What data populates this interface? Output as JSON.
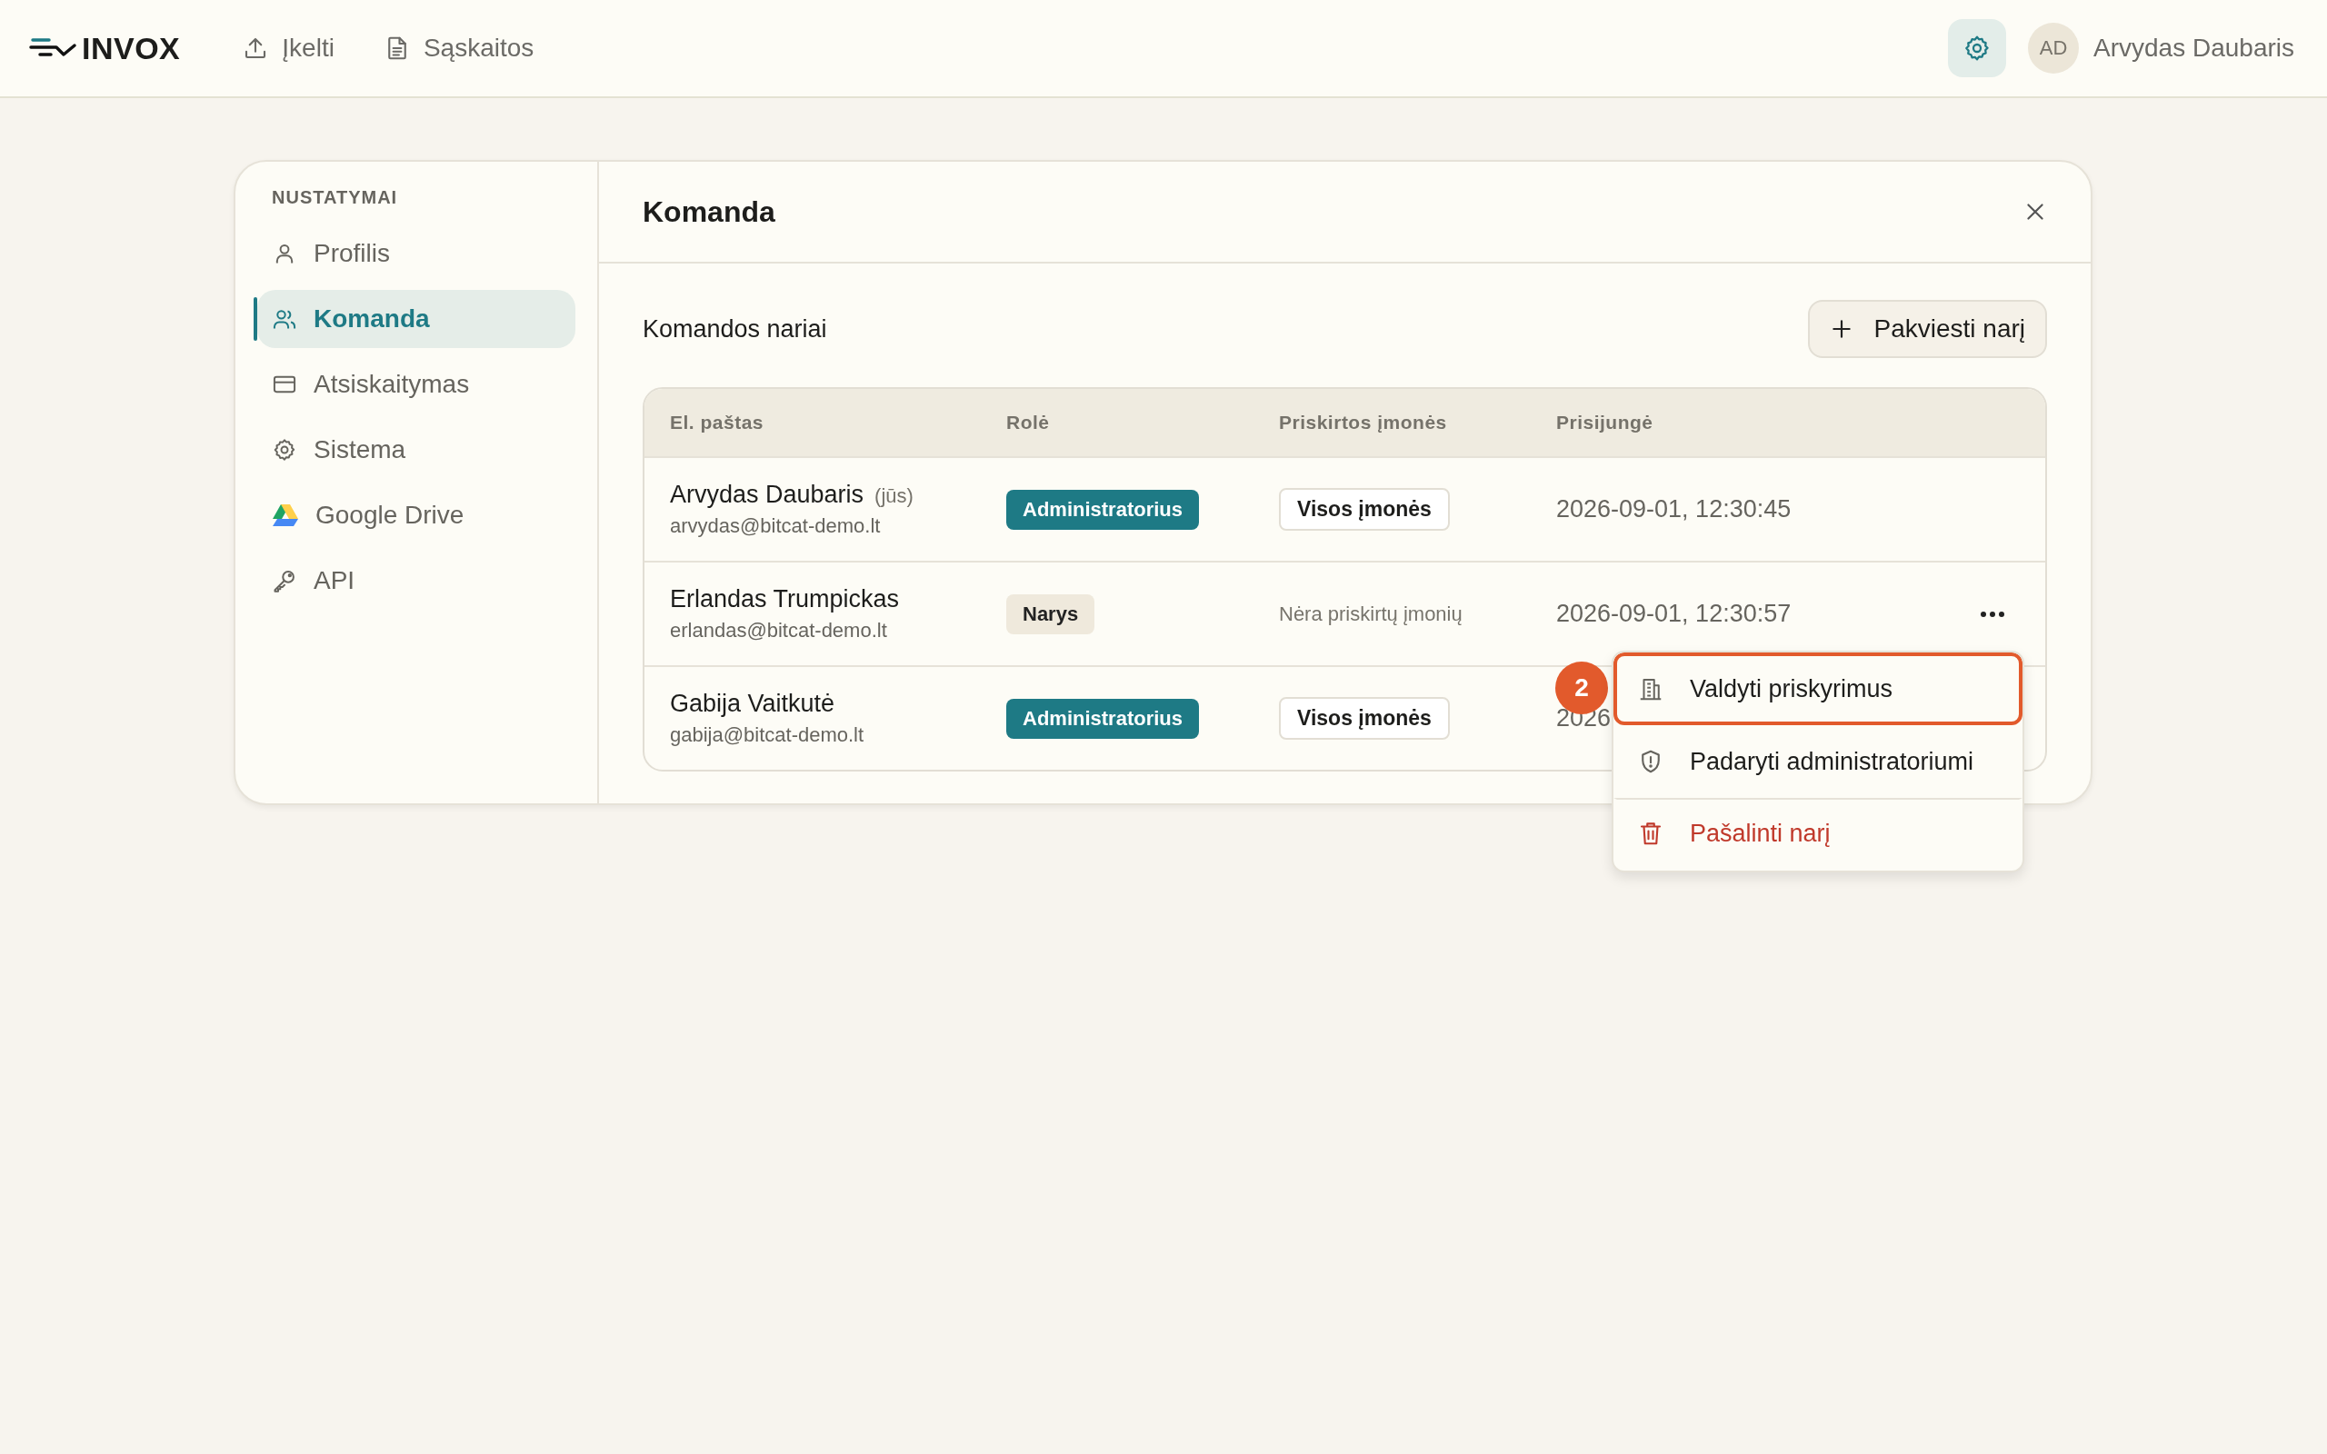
{
  "app": {
    "logo": "INVOX",
    "nav": [
      {
        "label": "Įkelti",
        "kind": "upload"
      },
      {
        "label": "Sąskaitos",
        "kind": "document"
      }
    ],
    "settings_active": true,
    "avatar": "AD",
    "user_name": "Arvydas Daubaris"
  },
  "sidebar": {
    "heading": "NUSTATYMAI",
    "items": [
      {
        "label": "Profilis",
        "kind": "user",
        "selected": false
      },
      {
        "label": "Komanda",
        "kind": "users",
        "selected": true
      },
      {
        "label": "Atsiskaitymas",
        "kind": "card",
        "selected": false
      },
      {
        "label": "Sistema",
        "kind": "gear",
        "selected": false
      },
      {
        "label": "Google Drive",
        "kind": "drive",
        "selected": false
      },
      {
        "label": "API",
        "kind": "key",
        "selected": false
      }
    ]
  },
  "panel": {
    "title": "Komanda",
    "section_title": "Komandos nariai",
    "invite_button": "Pakviesti narį",
    "table": {
      "columns": [
        "El. paštas",
        "Rolė",
        "Priskirtos įmonės",
        "Prisijungė"
      ],
      "rows": [
        {
          "name": "Arvydas Daubaris",
          "you_tag": "(jūs)",
          "email": "arvydas@bitcat-demo.lt",
          "role": {
            "label": "Administratorius",
            "kind": "admin"
          },
          "companies": {
            "label": "Visos įmonės",
            "kind": "badge"
          },
          "last_login": "2026-09-01, 12:30:45",
          "more_button": false
        },
        {
          "name": "Erlandas Trumpickas",
          "email": "erlandas@bitcat-demo.lt",
          "role": {
            "label": "Narys",
            "kind": "member"
          },
          "companies": {
            "label": "Nėra priskirtų įmonių",
            "kind": "none"
          },
          "last_login": "2026-09-01, 12:30:57",
          "more_button": true
        },
        {
          "name": "Gabija Vaitkutė",
          "email": "gabija@bitcat-demo.lt",
          "role": {
            "label": "Administratorius",
            "kind": "admin"
          },
          "companies": {
            "label": "Visos įmonės",
            "kind": "badge"
          },
          "last_login": "2026",
          "more_button": false
        }
      ]
    }
  },
  "context_menu": {
    "step_badge": "2",
    "items": [
      {
        "label": "Valdyti priskyrimus",
        "kind": "building",
        "selected": true
      },
      {
        "label": "Padaryti administratoriumi",
        "kind": "shield",
        "selected": false
      },
      {
        "label": "Pašalinti narį",
        "kind": "danger",
        "selected": false
      }
    ]
  }
}
